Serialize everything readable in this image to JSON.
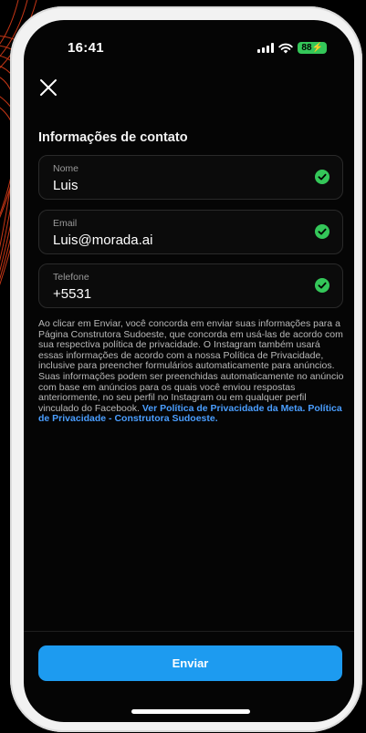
{
  "status": {
    "time": "16:41",
    "battery": "88"
  },
  "form": {
    "section_title": "Informações de contato",
    "fields": [
      {
        "label": "Nome",
        "value": "Luis"
      },
      {
        "label": "Email",
        "value": "Luis@morada.ai"
      },
      {
        "label": "Telefone",
        "value": "+5531"
      }
    ]
  },
  "disclaimer": {
    "text": "Ao clicar em Enviar, você concorda em enviar suas informações para a Página Construtora Sudoeste, que concorda em usá-las de acordo com sua respectiva política de privacidade. O Instagram também usará essas informações de acordo com a nossa Política de Privacidade, inclusive para preencher formulários automaticamente para anúncios. Suas informações podem ser preenchidas automaticamente no anúncio com base em anúncios para os quais você enviou respostas anteriormente, no seu perfil no Instagram ou em qualquer perfil vinculado do Facebook. ",
    "link_meta": "Ver Política de Privacidade da Meta.",
    "link_company": "Política de Privacidade - Construtora Sudoeste."
  },
  "actions": {
    "submit_label": "Enviar"
  },
  "colors": {
    "accent": "#1d9bf0",
    "link": "#4a9eff",
    "check": "#34c759",
    "background_lines": "#e8401a"
  },
  "icons": {
    "close": "close-icon",
    "check": "check-circle-icon",
    "signal": "cellular-signal-icon",
    "wifi": "wifi-icon"
  }
}
